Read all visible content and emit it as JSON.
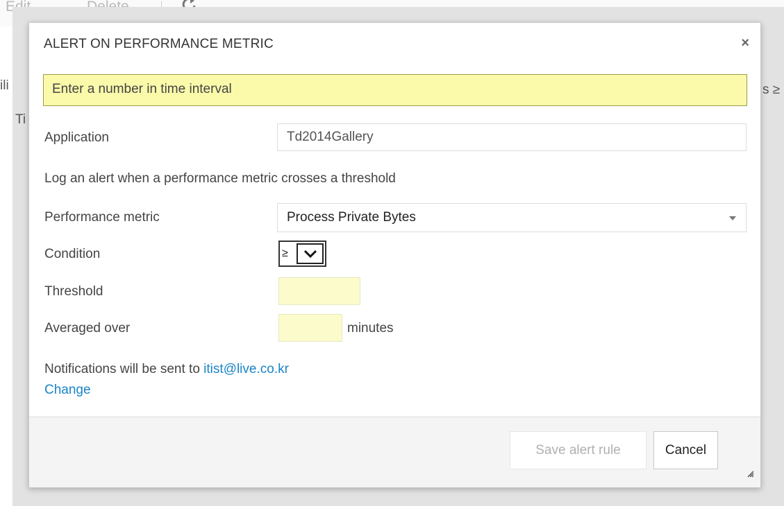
{
  "background": {
    "toolbar": {
      "edit_label": "Edit",
      "delete_label": "Delete"
    },
    "fragments": {
      "left_1": "ili",
      "left_2": "Ti",
      "right_1": "s ≥"
    }
  },
  "dialog": {
    "title": "ALERT ON PERFORMANCE METRIC",
    "close_symbol": "×",
    "warning": "Enter a number in time interval",
    "application": {
      "label": "Application",
      "value": "Td2014Gallery"
    },
    "info_text": "Log an alert when a performance metric crosses a threshold",
    "performance_metric": {
      "label": "Performance metric",
      "value": "Process Private Bytes"
    },
    "condition": {
      "label": "Condition",
      "value": "≥"
    },
    "threshold": {
      "label": "Threshold",
      "value": ""
    },
    "averaged_over": {
      "label": "Averaged over",
      "value": "",
      "unit": "minutes"
    },
    "notification": {
      "prefix": "Notifications will be sent to ",
      "email": "itist@live.co.kr",
      "change_link": "Change"
    },
    "buttons": {
      "save": "Save alert rule",
      "cancel": "Cancel"
    }
  },
  "icons": {
    "refresh": "refresh-icon",
    "close": "close-icon",
    "condition_dropdown": "chevron-down-icon",
    "metric_dropdown": "caret-down-icon",
    "resize": "resize-grip-icon"
  },
  "colors": {
    "warning_bg": "#fbfaaa",
    "input_highlight": "#fbfbcc",
    "link": "#1a84c7",
    "overlay": "#e2e2e2"
  }
}
